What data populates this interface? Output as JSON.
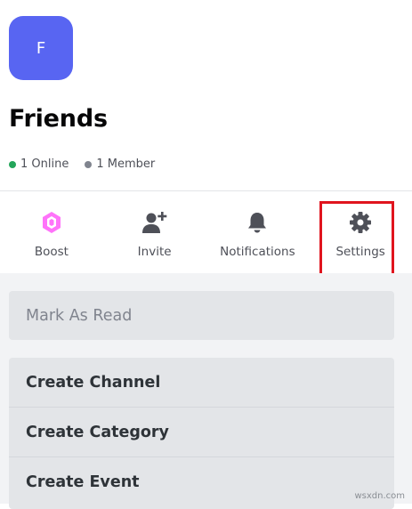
{
  "server": {
    "initial": "F",
    "name": "Friends",
    "icon_color": "#5865f2"
  },
  "stats": {
    "online": "1 Online",
    "members": "1 Member",
    "online_color": "#23a55a",
    "member_color": "#80848e"
  },
  "actions": [
    {
      "label": "Boost",
      "icon": "boost-gem-icon"
    },
    {
      "label": "Invite",
      "icon": "add-person-icon"
    },
    {
      "label": "Notifications",
      "icon": "bell-icon"
    },
    {
      "label": "Settings",
      "icon": "gear-icon"
    }
  ],
  "highlight_color": "#e0141e",
  "mark_as_read": "Mark As Read",
  "menu": [
    {
      "label": "Create Channel"
    },
    {
      "label": "Create Category"
    },
    {
      "label": "Create Event"
    }
  ],
  "watermark": "wsxdn.com"
}
